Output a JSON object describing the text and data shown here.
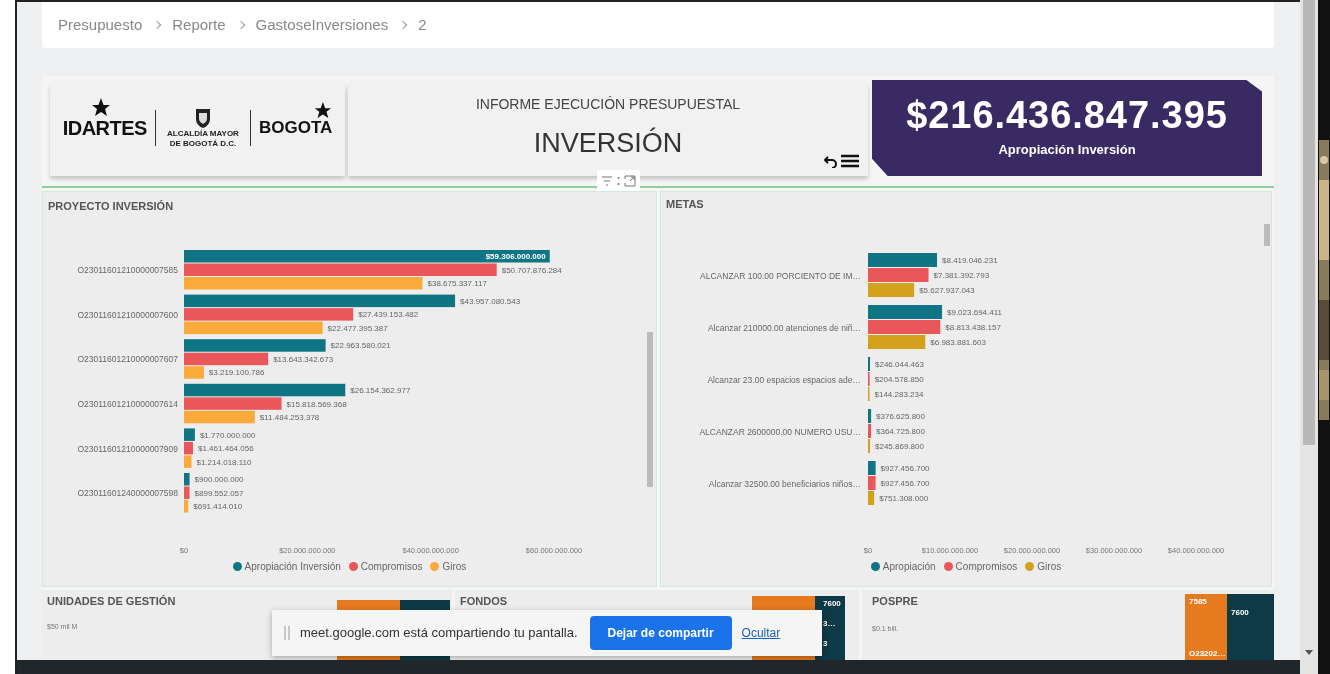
{
  "breadcrumb": [
    "Presupuesto",
    "Reporte",
    "GastoseInversiones",
    "2"
  ],
  "logos": {
    "idartes": "IDARTES",
    "alcaldia": "ALCALDÍA MAYOR DE BOGOTÁ D.C.",
    "bogota": "BOGOTA"
  },
  "report_header": {
    "subtitle": "INFORME EJECUCIÓN PRESUPUESTAL",
    "title": "INVERSIÓN"
  },
  "kpi": {
    "value": "$216.436.847.395",
    "label": "Apropiación Inversión"
  },
  "proyecto_inversion": {
    "title": "PROYECTO INVERSIÓN",
    "chart_data": {
      "type": "bar",
      "orientation": "horizontal",
      "categories": [
        "O23011601210000007585",
        "O23011601210000007600",
        "O23011601210000007607",
        "O23011601210000007614",
        "O23011601210000007909",
        "O23011601240000007598"
      ],
      "series": [
        {
          "name": "Apropiación Inversión",
          "color": "#0f7584",
          "values": [
            59306000000,
            43957080543,
            22963580021,
            26154362977,
            1770000000,
            900000000
          ]
        },
        {
          "name": "Compromisos",
          "color": "#e9575b",
          "values": [
            50707876284,
            27439153482,
            13643342673,
            15818569368,
            1461464056,
            899552057
          ]
        },
        {
          "name": "Giros",
          "color": "#f9aa3a",
          "values": [
            38675337117,
            22477395387,
            3219100786,
            11484253378,
            1214018110,
            691414010
          ]
        }
      ],
      "value_labels": [
        [
          "$59.306.000.000",
          "$43.957.080.543",
          "$22.963.580.021",
          "$26.154.362.977",
          "$1.770.000.000",
          "$900.000.000"
        ],
        [
          "$50.707.876.284",
          "$27.439.153.482",
          "$13.643.342.673",
          "$15.818.569.368",
          "$1.461.464.056",
          "$899.552.057"
        ],
        [
          "$38.675.337.117",
          "$22.477.395.387",
          "$3.219.100.786",
          "$11.484.253.378",
          "$1.214.018.110",
          "$691.414.010"
        ]
      ],
      "xlim": [
        0,
        60000000000
      ],
      "xticks": [
        {
          "value": 0,
          "label": "$0"
        },
        {
          "value": 20000000000,
          "label": "$20.000.000.000"
        },
        {
          "value": 40000000000,
          "label": "$40.000.000.000"
        },
        {
          "value": 60000000000,
          "label": "$60.000.000.000"
        }
      ]
    }
  },
  "metas": {
    "title": "METAS",
    "chart_data": {
      "type": "bar",
      "orientation": "horizontal",
      "categories": [
        "ALCANZAR 100.00 PORCIENTO DE IM…",
        "Alcanzar 210000.00 atenciones de niñ…",
        "Alcanzar 23.00 espacios espacios ade…",
        "ALCANZAR 2600000.00 NUMERO USU…",
        "Alcanzar 32500.00 beneficiarios niños…"
      ],
      "series": [
        {
          "name": "Apropiación",
          "color": "#0f7584",
          "values": [
            8419046231,
            9023694411,
            246044463,
            376625800,
            927456700
          ]
        },
        {
          "name": "Compromisos",
          "color": "#e9575b",
          "values": [
            7381392793,
            8813438157,
            204578850,
            364725800,
            927456700
          ]
        },
        {
          "name": "Giros",
          "color": "#d4a21a",
          "values": [
            5627937043,
            6983881603,
            144283234,
            245869800,
            751308000
          ]
        }
      ],
      "value_labels": [
        [
          "$8.419.046.231",
          "$9.023.694.411",
          "$246.044.463",
          "$376.625.800",
          "$927.456.700"
        ],
        [
          "$7.381.392.793",
          "$8.813.438.157",
          "$204.578.850",
          "$364.725.800",
          "$927.456.700"
        ],
        [
          "$5.627.937.043",
          "$6.983.881.603",
          "$144.283.234",
          "$245.869.800",
          "$751.308.000"
        ]
      ],
      "xlim": [
        0,
        40000000000
      ],
      "xticks": [
        {
          "value": 0,
          "label": "$0"
        },
        {
          "value": 10000000000,
          "label": "$10.000.000.000"
        },
        {
          "value": 20000000000,
          "label": "$20.000.000.000"
        },
        {
          "value": 30000000000,
          "label": "$30.000.000.000"
        },
        {
          "value": 40000000000,
          "label": "$40.000.000.000"
        }
      ]
    }
  },
  "unidades": {
    "title": "UNIDADES DE GESTIÓN",
    "axis_label": "$50 mil M"
  },
  "fondos": {
    "title": "FONDOS",
    "tiles": [
      "7600",
      "3…",
      "3"
    ]
  },
  "pospre": {
    "title": "POSPRE",
    "axis_label": "$0.1 bill.",
    "tiles": [
      "7585",
      "7600",
      "O23202…"
    ]
  },
  "share_bar": {
    "message": "meet.google.com está compartiendo tu pantalla.",
    "stop_button": "Dejar de compartir",
    "hide_link": "Ocultar"
  }
}
